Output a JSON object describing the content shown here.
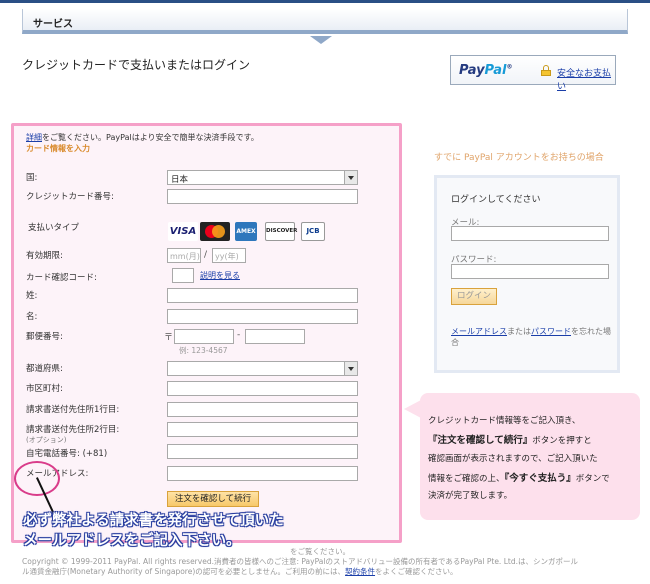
{
  "header": {
    "service_label": "サービス",
    "page_title": "クレジットカードで支払いまたはログイン"
  },
  "paypal": {
    "logo_pay": "Pay",
    "logo_pal": "Pal",
    "logo_tm": "®",
    "secure_link": "安全なお支払い"
  },
  "form": {
    "intro_link": "詳細",
    "intro_text": "をご覧ください。PayPalはより安全で簡単な決済手段です。",
    "section_title": "カード情報を入力",
    "country_label": "国:",
    "country_value": "日本",
    "card_number_label": "クレジットカード番号:",
    "payment_type_label": "支払いタイプ",
    "cards": {
      "visa": "VISA",
      "amex": "AMEX",
      "discover": "DISCOVER",
      "jcb": "JCB"
    },
    "expiry_label": "有効期限:",
    "expiry_month_placeholder": "mm(月)",
    "expiry_slash": "/",
    "expiry_year_placeholder": "yy(年)",
    "cvv_label": "カード確認コード:",
    "cvv_help_link": "説明を見る",
    "last_name_label": "姓:",
    "first_name_label": "名:",
    "postal_label": "郵便番号:",
    "postal_mark": "〒",
    "postal_dash": "-",
    "postal_example": "例: 123-4567",
    "prefecture_label": "都道府県:",
    "city_label": "市区町村:",
    "address1_label": "請求書送付先住所1行目:",
    "address2_label": "請求書送付先住所2行目:",
    "address2_optional": "(オプション)",
    "phone_label": "自宅電話番号: (+81)",
    "email_label": "メールアドレス:",
    "confirm_button": "注文を確認して続行"
  },
  "login": {
    "already_text": "すでに PayPal アカウントをお持ちの場合",
    "title": "ログインしてください",
    "email_label": "メール:",
    "password_label": "パスワード:",
    "button": "ログイン",
    "forgot_email": "メールアドレス",
    "forgot_or": "または",
    "forgot_password": "パスワード",
    "forgot_rest": "を忘れた場合"
  },
  "note": {
    "line1": "クレジットカード情報等をご記入頂き、",
    "line2_bold": "『注文を確認して続行』",
    "line2_rest": "ボタンを押すと",
    "line3": "確認画面が表示されますので、ご記入頂いた",
    "line4_pre": "情報をご確認の上、",
    "line4_bold": "『今すぐ支払う』",
    "line4_rest": "ボタンで",
    "line5": "決済が完了致します。"
  },
  "warning": {
    "line1": "必ず弊社よる請求書を発行させて頂いた",
    "line2": "メールアドレスをご記入下さい。"
  },
  "footer": {
    "line1": "をご覧ください。",
    "line2": "Copyright © 1999-2011 PayPal. All rights reserved.消費者の皆様へのご注意: PayPalのストアドバリュー設備の所有者であるPayPal Pte. Ltd.は、シンガポール",
    "line3_pre": "ル通貨金融庁(Monetary Authority of Singapore)の認可を必要としません。ご利用の前には、",
    "line3_link": "契約条件",
    "line3_post": "をよくご確認ください。"
  }
}
